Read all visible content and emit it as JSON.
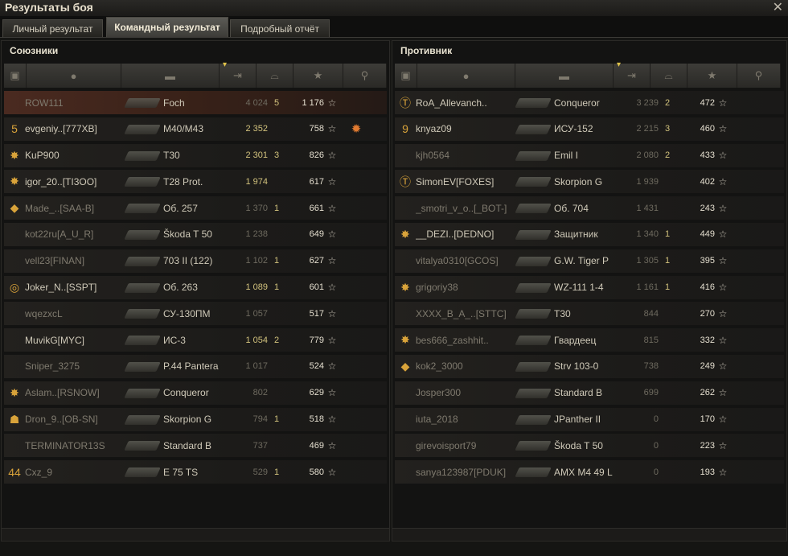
{
  "window": {
    "title": "Результаты боя",
    "close_icon": "close-icon"
  },
  "tabs": [
    {
      "label": "Личный результат",
      "active": false
    },
    {
      "label": "Командный результат",
      "active": true
    },
    {
      "label": "Подробный отчёт",
      "active": false
    }
  ],
  "allies": {
    "title": "Союзники",
    "header_icons": [
      "platoon-icon",
      "player-icon",
      "tank-icon",
      "damage-icon",
      "frags-icon",
      "xp-icon",
      "medal-icon"
    ],
    "rows": [
      {
        "badge": "",
        "name": "ROW111",
        "tank": "Foch",
        "damage": "4 024",
        "kills": "5",
        "xp": "1 176",
        "medal": "",
        "highlight": true,
        "dim": true,
        "dmg_hi": false
      },
      {
        "badge": "platoon-5-icon",
        "name": "evgeniy..[777XB]",
        "tank": "M40/M43",
        "damage": "2 352",
        "kills": "",
        "xp": "758",
        "medal": "order-medal-icon",
        "highlight": false,
        "dim": false,
        "dmg_hi": true
      },
      {
        "badge": "clan-star-icon",
        "name": "KuP900",
        "tank": "T30",
        "damage": "2 301",
        "kills": "3",
        "xp": "826",
        "medal": "",
        "highlight": false,
        "dim": false,
        "dmg_hi": true
      },
      {
        "badge": "clan-star-icon",
        "name": "igor_20..[TI3OO]",
        "tank": "T28 Prot.",
        "damage": "1 974",
        "kills": "",
        "xp": "617",
        "medal": "",
        "highlight": false,
        "dim": false,
        "dmg_hi": true
      },
      {
        "badge": "diamond-icon",
        "name": "Made_..[SAA-B]",
        "tank": "Об. 257",
        "damage": "1 370",
        "kills": "1",
        "xp": "661",
        "medal": "",
        "highlight": false,
        "dim": true,
        "dmg_hi": false
      },
      {
        "badge": "",
        "name": "kot22ru[A_U_R]",
        "tank": "Škoda T 50",
        "damage": "1 238",
        "kills": "",
        "xp": "649",
        "medal": "",
        "highlight": false,
        "dim": true,
        "dmg_hi": false
      },
      {
        "badge": "",
        "name": "vell23[FINAN]",
        "tank": "703 II (122)",
        "damage": "1 102",
        "kills": "1",
        "xp": "627",
        "medal": "",
        "highlight": false,
        "dim": true,
        "dmg_hi": false
      },
      {
        "badge": "ring-icon",
        "name": "Joker_N..[SSPT]",
        "tank": "Об. 263",
        "damage": "1 089",
        "kills": "1",
        "xp": "601",
        "medal": "",
        "highlight": false,
        "dim": false,
        "dmg_hi": true
      },
      {
        "badge": "",
        "name": "wqezxcL",
        "tank": "СУ-130ПМ",
        "damage": "1 057",
        "kills": "",
        "xp": "517",
        "medal": "",
        "highlight": false,
        "dim": true,
        "dmg_hi": false
      },
      {
        "badge": "",
        "name": "MuvikG[MYC]",
        "tank": "ИС-3",
        "damage": "1 054",
        "kills": "2",
        "xp": "779",
        "medal": "",
        "highlight": false,
        "dim": false,
        "dmg_hi": true
      },
      {
        "badge": "",
        "name": "Sniper_3275",
        "tank": "P.44 Pantera",
        "damage": "1 017",
        "kills": "",
        "xp": "524",
        "medal": "",
        "highlight": false,
        "dim": true,
        "dmg_hi": false
      },
      {
        "badge": "clan-star-icon",
        "name": "Aslam..[RSNOW]",
        "tank": "Conqueror",
        "damage": "802",
        "kills": "",
        "xp": "629",
        "medal": "",
        "highlight": false,
        "dim": true,
        "dmg_hi": false
      },
      {
        "badge": "clan-emblem-icon",
        "name": "Dron_9..[OB-SN]",
        "tank": "Skorpion G",
        "damage": "794",
        "kills": "1",
        "xp": "518",
        "medal": "",
        "highlight": false,
        "dim": true,
        "dmg_hi": false
      },
      {
        "badge": "",
        "name": "TERMINATOR13S",
        "tank": "Standard B",
        "damage": "737",
        "kills": "",
        "xp": "469",
        "medal": "",
        "highlight": false,
        "dim": true,
        "dmg_hi": false
      },
      {
        "badge": "platoon-44-icon",
        "name": "Cxz_9",
        "tank": "E 75 TS",
        "damage": "529",
        "kills": "1",
        "xp": "580",
        "medal": "",
        "highlight": false,
        "dim": true,
        "dmg_hi": false
      }
    ]
  },
  "enemies": {
    "title": "Противник",
    "header_icons": [
      "platoon-icon",
      "player-icon",
      "tank-icon",
      "damage-icon",
      "frags-icon",
      "xp-icon",
      "medal-icon"
    ],
    "rows": [
      {
        "badge": "clan-t-icon",
        "name": "RoA_Allevanch..",
        "tank": "Conqueror",
        "damage": "3 239",
        "kills": "2",
        "xp": "472",
        "dim": false,
        "dmg_hi": false
      },
      {
        "badge": "platoon-9-icon",
        "name": "knyaz09",
        "tank": "ИСУ-152",
        "damage": "2 215",
        "kills": "3",
        "xp": "460",
        "dim": false,
        "dmg_hi": false
      },
      {
        "badge": "",
        "name": "kjh0564",
        "tank": "Emil I",
        "damage": "2 080",
        "kills": "2",
        "xp": "433",
        "dim": true,
        "dmg_hi": false
      },
      {
        "badge": "clan-t-icon",
        "name": "SimonEV[FOXES]",
        "tank": "Skorpion G",
        "damage": "1 939",
        "kills": "",
        "xp": "402",
        "dim": false,
        "dmg_hi": false
      },
      {
        "badge": "",
        "name": "_smotri_v_o..[_BOT-]",
        "tank": "Об. 704",
        "damage": "1 431",
        "kills": "",
        "xp": "243",
        "dim": true,
        "dmg_hi": false
      },
      {
        "badge": "clan-star-icon",
        "name": "__DEZI..[DEDNO]",
        "tank": "Защитник",
        "damage": "1 340",
        "kills": "1",
        "xp": "449",
        "dim": false,
        "dmg_hi": false
      },
      {
        "badge": "",
        "name": "vitalya0310[GCOS]",
        "tank": "G.W. Tiger P",
        "damage": "1 305",
        "kills": "1",
        "xp": "395",
        "dim": true,
        "dmg_hi": false
      },
      {
        "badge": "clan-star-icon",
        "name": "grigoriy38",
        "tank": "WZ-111 1-4",
        "damage": "1 161",
        "kills": "1",
        "xp": "416",
        "dim": true,
        "dmg_hi": false
      },
      {
        "badge": "",
        "name": "XXXX_B_A_..[STTC]",
        "tank": "T30",
        "damage": "844",
        "kills": "",
        "xp": "270",
        "dim": true,
        "dmg_hi": false
      },
      {
        "badge": "clan-star-icon",
        "name": "bes666_zashhit..",
        "tank": "Гвардеец",
        "damage": "815",
        "kills": "",
        "xp": "332",
        "dim": true,
        "dmg_hi": false
      },
      {
        "badge": "diamond-icon",
        "name": "kok2_3000",
        "tank": "Strv 103-0",
        "damage": "738",
        "kills": "",
        "xp": "249",
        "dim": true,
        "dmg_hi": false
      },
      {
        "badge": "",
        "name": "Josper300",
        "tank": "Standard B",
        "damage": "699",
        "kills": "",
        "xp": "262",
        "dim": true,
        "dmg_hi": false
      },
      {
        "badge": "",
        "name": "iuta_2018",
        "tank": "JPanther II",
        "damage": "0",
        "kills": "",
        "xp": "170",
        "dim": true,
        "dmg_hi": false
      },
      {
        "badge": "",
        "name": "girevoisport79",
        "tank": "Škoda T 50",
        "damage": "0",
        "kills": "",
        "xp": "223",
        "dim": true,
        "dmg_hi": false
      },
      {
        "badge": "",
        "name": "sanya123987[PDUK]",
        "tank": "AMX M4 49 L",
        "damage": "0",
        "kills": "",
        "xp": "193",
        "dim": true,
        "dmg_hi": false
      }
    ]
  }
}
